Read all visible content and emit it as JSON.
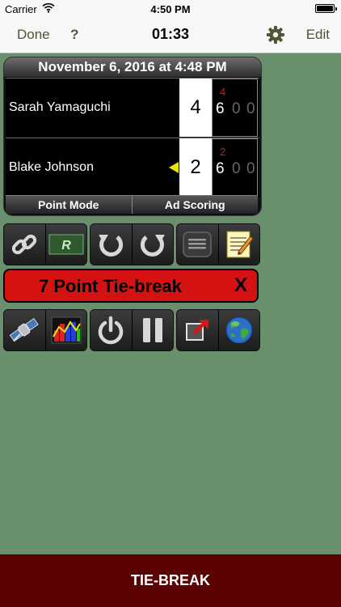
{
  "status_bar": {
    "carrier": "Carrier",
    "time": "4:50 PM",
    "signal_icon": "wifi-icon",
    "battery_icon": "battery-icon"
  },
  "nav": {
    "done_label": "Done",
    "help_label": "?",
    "clock": "01:33",
    "settings_icon": "gear-icon",
    "edit_label": "Edit"
  },
  "scoreboard": {
    "header": "November 6, 2016 at 4:48 PM",
    "players": [
      {
        "name": "Sarah Yamaguchi",
        "game": "4",
        "sets": [
          "6",
          "0",
          "0"
        ],
        "tiebreak": "4",
        "serving": false
      },
      {
        "name": "Blake Johnson",
        "game": "2",
        "sets": [
          "6",
          "0",
          "0"
        ],
        "tiebreak": "2",
        "serving": true
      }
    ],
    "footer": {
      "left": "Point Mode",
      "right": "Ad Scoring"
    }
  },
  "toolbar_row1": [
    {
      "icon": "link-chain-icon"
    },
    {
      "icon": "r-ratchet-icon",
      "text": "R"
    },
    {
      "icon": "undo-icon"
    },
    {
      "icon": "redo-icon"
    },
    {
      "icon": "keyboard-icon"
    },
    {
      "icon": "notes-icon"
    }
  ],
  "tiebreak_bar": {
    "label": "7 Point Tie-break",
    "close": "X"
  },
  "toolbar_row2": [
    {
      "icon": "satellite-icon"
    },
    {
      "icon": "stats-chart-icon"
    },
    {
      "icon": "power-icon"
    },
    {
      "icon": "pause-icon"
    },
    {
      "icon": "share-icon"
    },
    {
      "icon": "globe-icon"
    }
  ],
  "bottom": {
    "label": "TIE-BREAK"
  },
  "colors": {
    "background": "#698f6c",
    "bottom_bar": "#5b0202",
    "tiebreak": "#d51212",
    "nav_text": "#4e5633",
    "tiebreak_digit": "#e21a1a",
    "serve_indicator": "#e6e600"
  }
}
